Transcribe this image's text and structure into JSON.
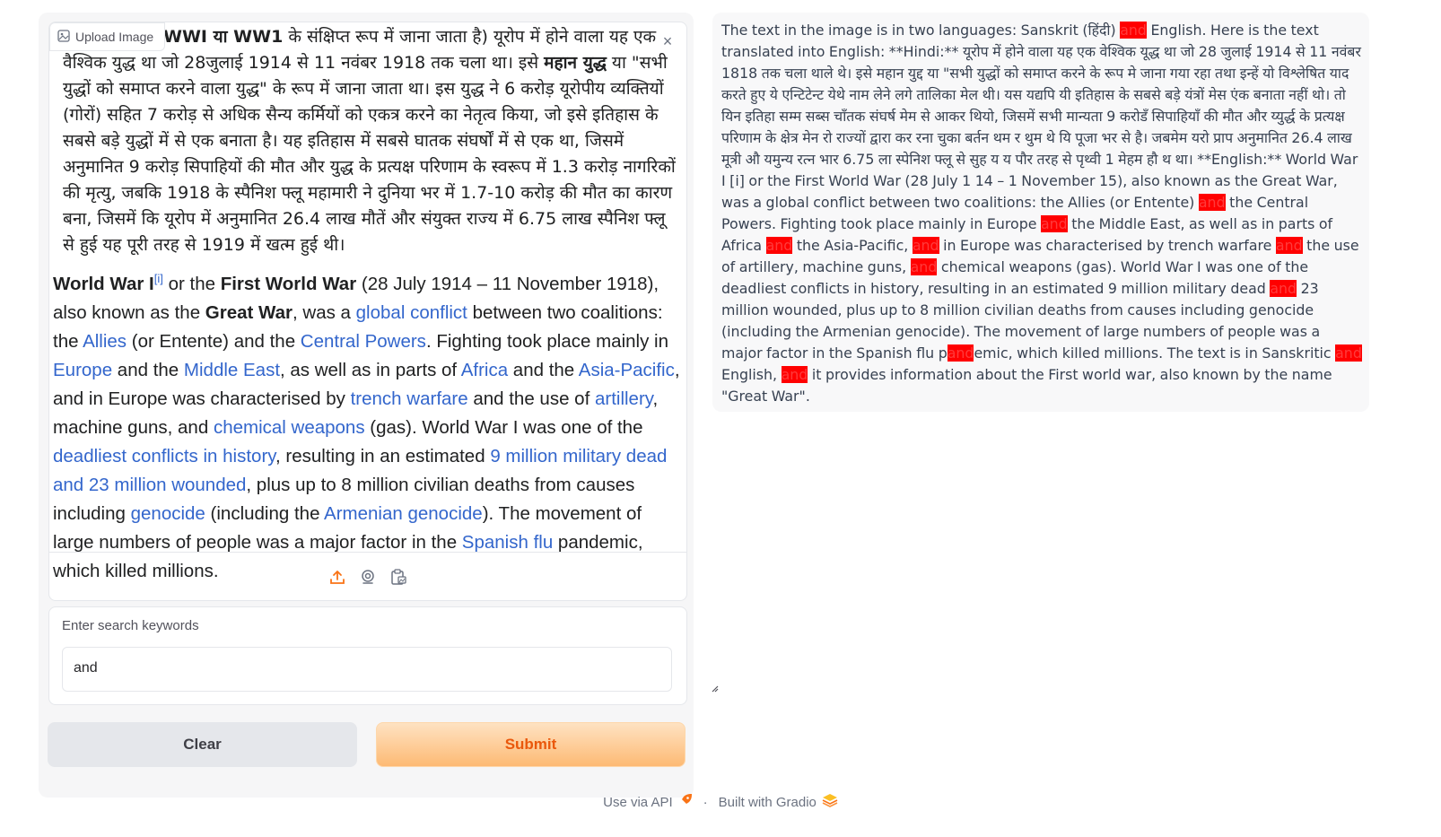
{
  "image_input": {
    "upload_label": "Upload Image",
    "close_symbol": "×",
    "screenshot": {
      "hindi_parts": [
        "WWI या WW1",
        " के संक्षिप्त रूप में जाना जाता है) यूरोप में होने वाला यह एक वैश्विक युद्ध था जो 28जुलाई 1914 से 11 नवंबर 1918 तक चला था। इसे ",
        "महान युद्ध",
        " या \"सभी युद्धों को समाप्त करने वाला युद्ध\" के रूप में जाना जाता था। इस युद्ध ने 6 करोड़ यूरोपीय व्यक्तियों (गोरों) सहित 7 करोड़ से अधिक सैन्य कर्मियों को एकत्र करने का नेतृत्व किया, जो इसे इतिहास के सबसे बड़े युद्धों में से एक बनाता है। यह इतिहास में सबसे घातक संघर्षों में से एक था, जिसमें अनुमानित 9 करोड़ सिपाहियों की मौत और युद्ध के प्रत्यक्ष परिणाम के स्वरूप में 1.3 करोड़ नागरिकों की मृत्यु, जबकि 1918 के स्पैनिश फ्लू महामारी ने दुनिया भर में 1.7-10 करोड़ की मौत का कारण बना, जिसमें कि यूरोप में अनुमानित 26.4 लाख मौतें और संयुक्त राज्य में 6.75 लाख स्पैनिश फ्लू से हुई यह पूरी तरह से 1919 में खत्म हुई थी।"
      ],
      "english_parts": [
        {
          "t": "World War I",
          "s": "b"
        },
        {
          "t": "[i]",
          "s": "sup"
        },
        {
          "t": " or the ",
          "s": ""
        },
        {
          "t": "First World War",
          "s": "b"
        },
        {
          "t": " (28 July 1914 – 11 November 1918), also known as the ",
          "s": ""
        },
        {
          "t": "Great War",
          "s": "b"
        },
        {
          "t": ", was a ",
          "s": ""
        },
        {
          "t": "global conflict",
          "s": "a"
        },
        {
          "t": " between two coalitions: the ",
          "s": ""
        },
        {
          "t": "Allies",
          "s": "a"
        },
        {
          "t": " (or Entente) and the ",
          "s": ""
        },
        {
          "t": "Central Powers",
          "s": "a"
        },
        {
          "t": ". Fighting took place mainly in ",
          "s": ""
        },
        {
          "t": "Europe",
          "s": "a"
        },
        {
          "t": " and the ",
          "s": ""
        },
        {
          "t": "Middle East",
          "s": "a"
        },
        {
          "t": ", as well as in parts of ",
          "s": ""
        },
        {
          "t": "Africa",
          "s": "a"
        },
        {
          "t": " and the ",
          "s": ""
        },
        {
          "t": "Asia-Pacific",
          "s": "a"
        },
        {
          "t": ", and in Europe was characterised by ",
          "s": ""
        },
        {
          "t": "trench warfare",
          "s": "a"
        },
        {
          "t": " and the use of ",
          "s": ""
        },
        {
          "t": "artillery",
          "s": "a"
        },
        {
          "t": ", machine guns, and ",
          "s": ""
        },
        {
          "t": "chemical weapons",
          "s": "a"
        },
        {
          "t": " (gas). World War I was one of the ",
          "s": ""
        },
        {
          "t": "deadliest conflicts in history",
          "s": "a"
        },
        {
          "t": ", resulting in an estimated ",
          "s": ""
        },
        {
          "t": "9 million military dead and 23 million wounded",
          "s": "a"
        },
        {
          "t": ", plus up to 8 million civilian deaths from causes including ",
          "s": ""
        },
        {
          "t": "genocide",
          "s": "a"
        },
        {
          "t": " (including the ",
          "s": ""
        },
        {
          "t": "Armenian genocide",
          "s": "a"
        },
        {
          "t": "). The movement of large numbers of people was a major factor in the ",
          "s": ""
        },
        {
          "t": "Spanish flu",
          "s": "a"
        },
        {
          "t": " pandemic, which killed millions.",
          "s": ""
        }
      ]
    },
    "toolbar": [
      "upload-icon",
      "webcam-icon",
      "clipboard-icon"
    ]
  },
  "search": {
    "label": "Enter search keywords",
    "value": "and"
  },
  "buttons": {
    "clear": "Clear",
    "submit": "Submit"
  },
  "output": {
    "segments": [
      {
        "t": "The text in the image is in two languages: Sanskrit (हिंदी) ",
        "h": false
      },
      {
        "t": "and",
        "h": true
      },
      {
        "t": " English. Here is the text translated into English: **Hindi:** यूरोप में होने वाला यह एक वेश्विक यूद्ध था जो 28 जुलाई 1914 से 11 नवंबर 1818 तक चला थाले थे। इसे महान युद्द या \"सभी युद्धों को समाप्त करने के रूप मे जाना गया रहा तथा इन्हें यो विश्लेषित याद करते हुए ये एन्टिटेन्ट येथे नाम लेने लगे तालिका मेल थी। यस यद्यपि यी इतिहास के सबसे बड़े यंत्रों मेस एंक बनाता नहीं थो। तो यिन इतिहा सम्म सब्स चाँतक संघर्ष मेम से आकर थियो, जिसमें सभी मान्यता 9 करोडँ सिपाहियाँ की मौत और य्युर्द्ध के प्रत्यक्ष परिणाम के क्षेत्र मेन रो राज्यों द्वारा कर रना चुका बर्तन थम र थुम थे यि पूजा भर से है। जबमेम यरो प्राप अनुमानित 26.4 लाख मूत्री औ यमुन्य रत्न भार 6.75 ला स्पेनिश फ्लू से सुह य य पौर तरह से पृथ्वी 1 मेहम हौ थ था। **English:** World War I [i] or the First World War (28 July 1 14 – 1 November 15), also known as the Great War, was a global conflict between two coalitions: the Allies (or Entente) ",
        "h": false
      },
      {
        "t": "and",
        "h": true
      },
      {
        "t": " the Central Powers. Fighting took place mainly in Europe ",
        "h": false
      },
      {
        "t": "and",
        "h": true
      },
      {
        "t": " the Middle East, as well as in parts of Africa ",
        "h": false
      },
      {
        "t": "and",
        "h": true
      },
      {
        "t": " the Asia-Pacific, ",
        "h": false
      },
      {
        "t": "and",
        "h": true
      },
      {
        "t": " in Europe was characterised by trench warfare ",
        "h": false
      },
      {
        "t": "and",
        "h": true
      },
      {
        "t": " the use of artillery, machine guns, ",
        "h": false
      },
      {
        "t": "and",
        "h": true
      },
      {
        "t": " chemical weapons (gas). World War I was one of the deadliest conflicts in history, resulting in an estimated 9 million military dead ",
        "h": false
      },
      {
        "t": "and",
        "h": true
      },
      {
        "t": " 23 million wounded, plus up to 8 million civilian deaths from causes including genocide (including the Armenian genocide). The movement of large numbers of people was a major factor in the Spanish flu p",
        "h": false
      },
      {
        "t": "and",
        "h": true
      },
      {
        "t": "emic, which killed millions. The text is in Sanskritic ",
        "h": false
      },
      {
        "t": "and",
        "h": true
      },
      {
        "t": " English, ",
        "h": false
      },
      {
        "t": "and",
        "h": true
      },
      {
        "t": " it provides information about the First world war, also known by the name \"Great War\".",
        "h": false
      }
    ]
  },
  "footer": {
    "api": "Use via API",
    "separator": "·",
    "built": "Built with Gradio"
  },
  "colors": {
    "highlight": "#ff0000",
    "link": "#3366cc",
    "submit_text": "#ea580c"
  }
}
